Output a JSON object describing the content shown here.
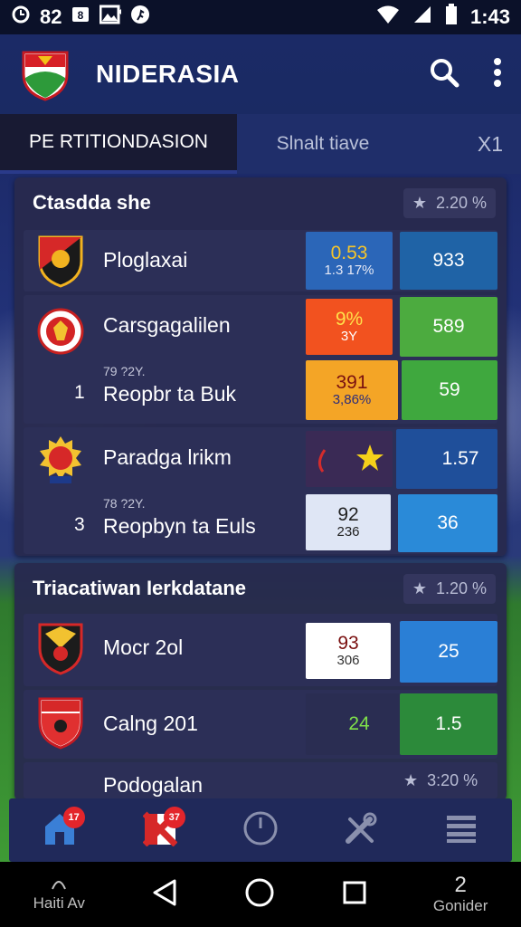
{
  "status_bar": {
    "left_text": "82",
    "time": "1:43",
    "icons": [
      "clock-icon",
      "badge-icon",
      "image-icon",
      "runner-icon",
      "wifi-icon",
      "signal-icon",
      "battery-icon"
    ]
  },
  "app_bar": {
    "title": "NIDERASIA",
    "actions": [
      "search-icon",
      "more-vert-icon"
    ]
  },
  "tabs": [
    {
      "label": "PE RTITIONDASION",
      "active": true
    },
    {
      "label": "Slnalt tiave",
      "active": false
    },
    {
      "label": "X1",
      "active": false
    }
  ],
  "sections": [
    {
      "title": "Ctasdda she",
      "badge": "2.20 %",
      "rows": [
        {
          "name": "Ploglaxai",
          "cells": [
            {
              "line1": "0.53",
              "line2": "1.3 17%"
            },
            {
              "line1": "933"
            }
          ]
        },
        {
          "name": "Carsgagalilen",
          "cells": [
            {
              "line1": "9%",
              "line2": "3Y"
            },
            {
              "line1": "589"
            }
          ],
          "sub_label": "79 ?2Y.",
          "rank": "1",
          "sub_name": "Reopbr ta Buk",
          "sub_cells": [
            {
              "line1": "391",
              "line2": "3,86%"
            },
            {
              "line1": "59"
            }
          ]
        },
        {
          "name": "Paradga lrikm",
          "cells": [
            {
              "line1": ""
            },
            {
              "line1": "1.57"
            }
          ],
          "sub_label": "78 ?2Y.",
          "rank": "3",
          "sub_name": "Reopbyn ta Euls",
          "sub_cells": [
            {
              "line1": "92",
              "line2": "236"
            },
            {
              "line1": "36"
            }
          ]
        }
      ]
    },
    {
      "title": "Triacatiwan Ierkdatane",
      "badge": "1.20 %",
      "rows": [
        {
          "name": "Mocr 2ol",
          "cells": [
            {
              "line1": "93",
              "line2": "306"
            },
            {
              "line1": "25"
            }
          ]
        },
        {
          "name": "Calng 201",
          "cells": [
            {
              "line1": "24"
            },
            {
              "line1": "1.5"
            }
          ]
        },
        {
          "name": "Podogalan",
          "badge": "3:20 %"
        }
      ]
    }
  ],
  "bottom_nav": [
    {
      "icon": "home-icon",
      "badge": "17"
    },
    {
      "icon": "flag-icon",
      "badge": "37"
    },
    {
      "icon": "compass-icon",
      "badge": ""
    },
    {
      "icon": "tools-icon",
      "badge": ""
    },
    {
      "icon": "menu-icon",
      "badge": ""
    }
  ],
  "system_nav": {
    "left_label": "Haiti Av",
    "right_number": "2",
    "right_label": "Gonider"
  },
  "colors": {
    "background": "#0d1430",
    "panel": "#282a4e",
    "accent_blue": "#2a6fd1",
    "accent_green": "#3fb04a",
    "accent_orange": "#f5a623",
    "accent_red": "#e3252b",
    "star_yellow": "#f5d11a"
  }
}
